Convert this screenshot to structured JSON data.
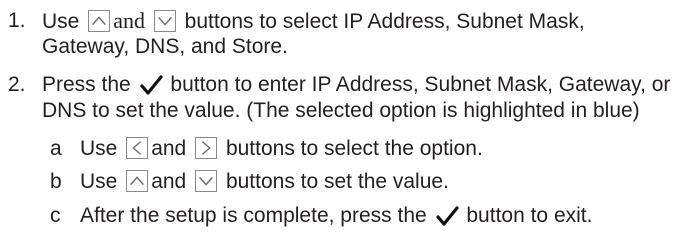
{
  "items": [
    {
      "number": "1.",
      "line1": {
        "pre": "Use",
        "up_icon": "up-arrow-button",
        "mid": "and",
        "down_icon": "down-arrow-button",
        "post": "buttons to select IP Address, Subnet Mask,"
      },
      "line2": "Gateway, DNS, and Store."
    },
    {
      "number": "2.",
      "line1": {
        "pre": "Press the",
        "check_icon": "checkmark-button",
        "post": "button to enter IP Address, Subnet Mask, Gateway, or"
      },
      "line2": "DNS to set the value. (The selected option is highlighted in blue)",
      "subitems": [
        {
          "letter": "a",
          "pre": "Use",
          "icon1": "left-arrow-button",
          "mid": "and",
          "icon2": "right-arrow-button",
          "post": "buttons to select the option."
        },
        {
          "letter": "b",
          "pre": "Use",
          "icon1": "up-arrow-button",
          "mid": "and",
          "icon2": "down-arrow-button",
          "post": "buttons to set the value."
        },
        {
          "letter": "c",
          "pre": "After the setup is complete, press the",
          "icon": "checkmark-button",
          "post": "button to exit."
        }
      ]
    }
  ],
  "colors": {
    "text": "#231f20",
    "icon_border": "#8a8a8a",
    "icon_arrow": "#6e6e6e",
    "check": "#111111"
  }
}
